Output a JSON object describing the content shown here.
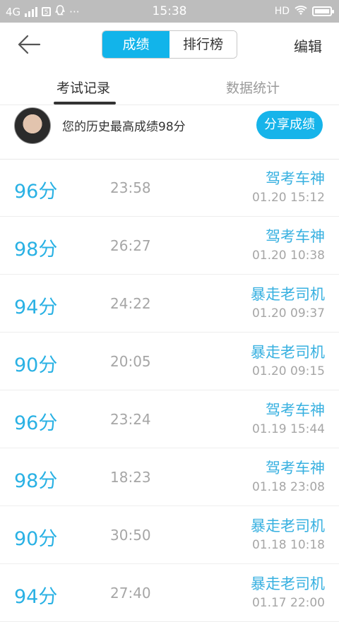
{
  "status_bar": {
    "network": "4G",
    "time": "15:38",
    "hd": "HD",
    "more": "···"
  },
  "nav": {
    "seg_score": "成绩",
    "seg_rank": "排行榜",
    "edit": "编辑"
  },
  "tabs": {
    "exam_records": "考试记录",
    "stats": "数据统计"
  },
  "best": {
    "text": "您的历史最高成绩98分",
    "share": "分享成绩"
  },
  "records": [
    {
      "score": "96分",
      "duration": "23:58",
      "title": "驾考车神",
      "date": "01.20  15:12"
    },
    {
      "score": "98分",
      "duration": "26:27",
      "title": "驾考车神",
      "date": "01.20  10:38"
    },
    {
      "score": "94分",
      "duration": "24:22",
      "title": "暴走老司机",
      "date": "01.20  09:37"
    },
    {
      "score": "90分",
      "duration": "20:05",
      "title": "暴走老司机",
      "date": "01.20  09:15"
    },
    {
      "score": "96分",
      "duration": "23:24",
      "title": "驾考车神",
      "date": "01.19  15:44"
    },
    {
      "score": "98分",
      "duration": "18:23",
      "title": "驾考车神",
      "date": "01.18  23:08"
    },
    {
      "score": "90分",
      "duration": "30:50",
      "title": "暴走老司机",
      "date": "01.18  10:18"
    },
    {
      "score": "94分",
      "duration": "27:40",
      "title": "暴走老司机",
      "date": "01.17  22:00"
    }
  ],
  "colors": {
    "accent": "#12b4ea",
    "score": "#29b1e4",
    "muted": "#a6a6a6"
  }
}
